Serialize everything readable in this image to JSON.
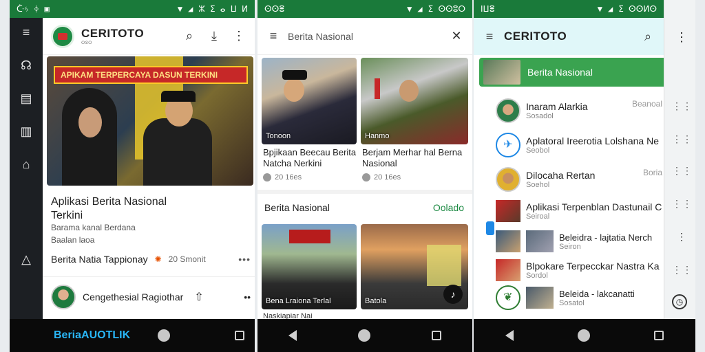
{
  "status_bars": [
    {
      "left": "ᑤᛃ ᛄ",
      "time": "ⵣ ⵉ ⴰ ⵡ ⵍ"
    },
    {
      "left": "ⵙⵙⴻ",
      "time": "ⵉ ⵙⵙⵓⵔ"
    },
    {
      "left": "ⵏⵡⴻ",
      "time": "ⵉ ⵙⵙⵍⵙ"
    },
    {
      "left": "ⴷⴳ",
      "time": ""
    }
  ],
  "panel1": {
    "brand": "CERITOTO",
    "brand_sub": "ⵙⵓⵔ",
    "hero_banner": "APIKAM TERPERCAYA DASUN TERKINI",
    "title": "Aplikasi Berita Nasional Terkini",
    "sub1": "Barama kanal Berdana",
    "sub2": "Baalan laoa",
    "meta_label": "Berita Natia Tappionay",
    "meta_time": "20 Smonit",
    "author": "Cengethesial Ragiothar"
  },
  "panel2": {
    "search_placeholder": "Berita Nasional",
    "cards": [
      {
        "caption": "Tonoon",
        "title": "Bpjikaan Beecau Berita Natcha Nerkini",
        "time": "20 16es"
      },
      {
        "caption": "Hanmo",
        "title": "Berjam Merhar hal Berna Nasional",
        "time": "20 16es"
      }
    ],
    "section": "Berita Nasional",
    "section_link": "Oolado",
    "row2": [
      {
        "caption": "Bena Lraiona Terlal"
      },
      {
        "caption": "Batola"
      }
    ],
    "bottom_text": "Naskiapiar Nai"
  },
  "panel3": {
    "brand": "CERITOTO",
    "highlight": "Berita Nasional",
    "items": [
      {
        "title": "Inaram Alarkia",
        "sub": "Sosadol",
        "right": "Beanoal"
      },
      {
        "title": "Aplatoral Ireerotia Lolshana Ne",
        "sub": "Seobol",
        "right": ""
      },
      {
        "title": "Dilocaha Rertan",
        "sub": "Soehol",
        "right": "Boria"
      },
      {
        "title": "Aplikasi Terpenblan Dastunail C",
        "sub": "Seiroal",
        "right": ""
      },
      {
        "title": "Beleidra - lajtatia Nerch",
        "sub": "Seiron",
        "right": ""
      },
      {
        "title": "Blpokare Terpecckar Nastra Ka",
        "sub": "Sordol",
        "right": ""
      },
      {
        "title": "Beleida - lakcanatti",
        "sub": "Sosatol",
        "right": ""
      }
    ]
  },
  "bottom_left_text": "BeriaAUOTLIK"
}
